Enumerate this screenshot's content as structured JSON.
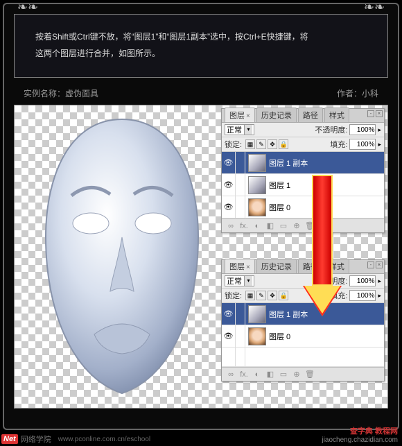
{
  "instruction": {
    "line1": "按着Shift或Ctrl键不放，将“图层1”和“图层1副本”选中，按Ctrl+E快捷键，将",
    "line2": "这两个图层进行合并，如图所示。"
  },
  "meta": {
    "example_label": "实例名称：虚伪面具",
    "author_label": "作者：小科"
  },
  "panel_tabs": {
    "layers": "图层",
    "history": "历史记录",
    "paths": "路径",
    "styles": "样式"
  },
  "panel_controls": {
    "blend_mode": "正常",
    "opacity_label": "不透明度:",
    "opacity_value": "100%",
    "lock_label": "锁定:",
    "fill_label": "填充:",
    "fill_value": "100%"
  },
  "panel1": {
    "layers": [
      {
        "name": "图层 1 副本",
        "selected": true,
        "thumb": "mask"
      },
      {
        "name": "图层 1",
        "selected": false,
        "thumb": "mask"
      },
      {
        "name": "图层 0",
        "selected": false,
        "thumb": "face"
      }
    ]
  },
  "panel2": {
    "layers": [
      {
        "name": "图层 1 副本",
        "selected": true,
        "thumb": "mask"
      },
      {
        "name": "图层 0",
        "selected": false,
        "thumb": "face"
      }
    ]
  },
  "footer_icons": [
    "∞",
    "fx.",
    "◐",
    "◧",
    "▭",
    "⊕",
    "🗑"
  ],
  "watermark": {
    "left_brand": "Net",
    "left_text": "网络学院",
    "left_url": "www.pconline.com.cn/eschool",
    "right_brand": "查字典 教程网",
    "right_url": "jiaocheng.chazidian.com"
  }
}
